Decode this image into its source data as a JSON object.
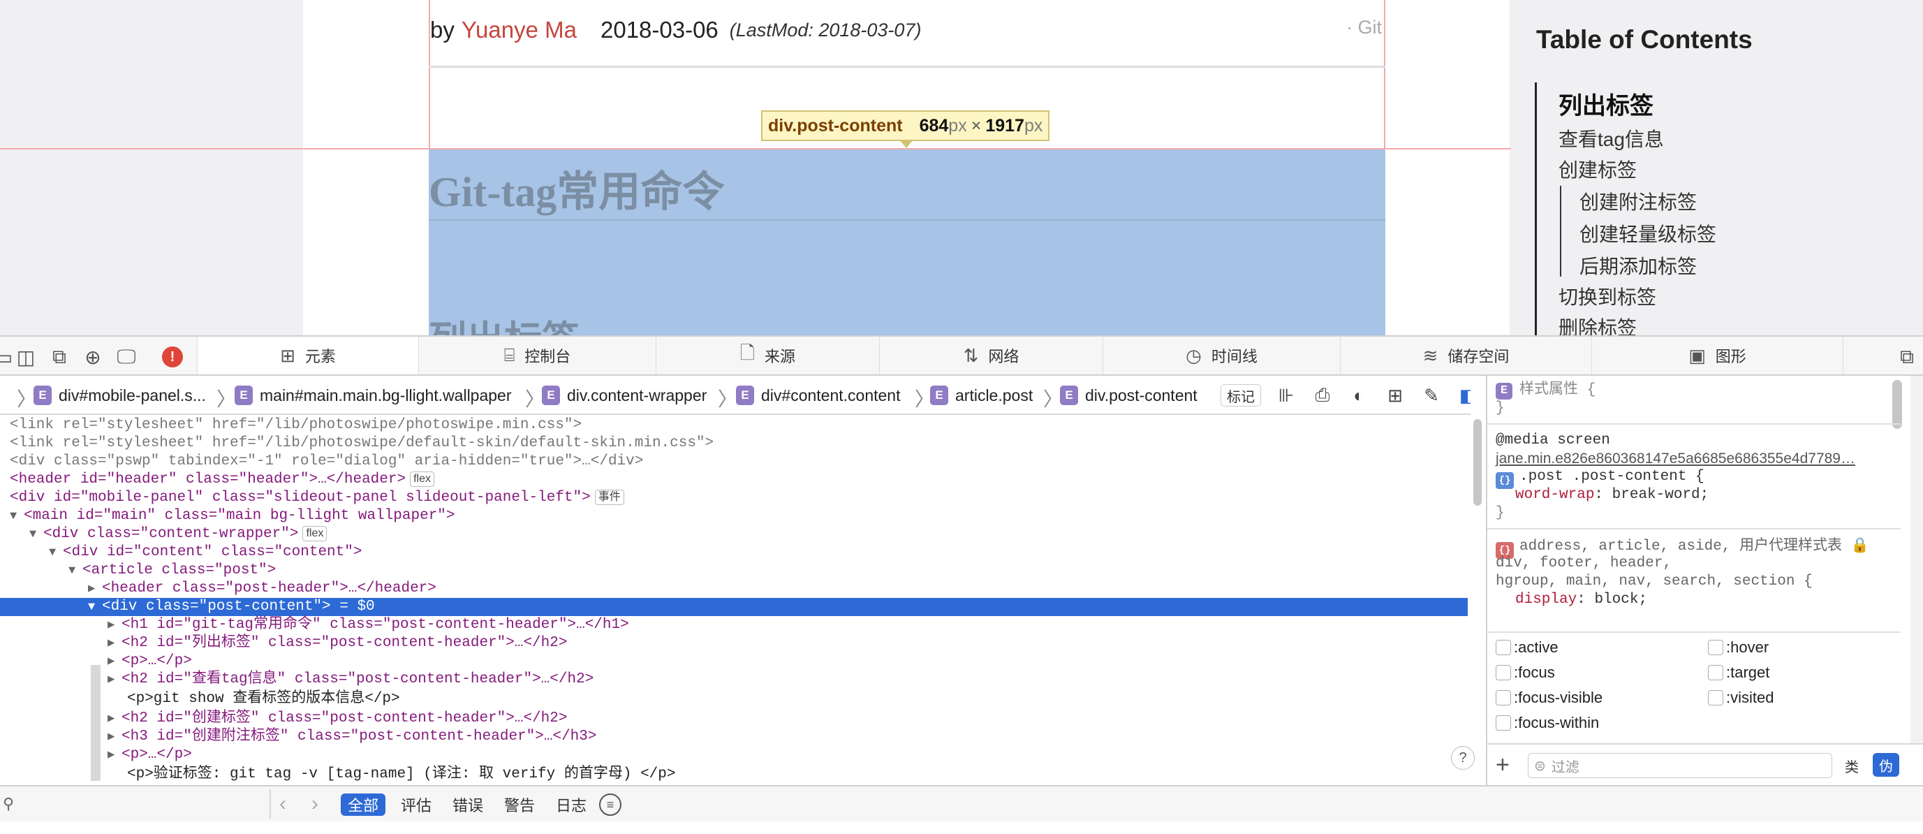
{
  "article": {
    "by_label": "by",
    "author": "Yuanye Ma",
    "date": "2018-03-06",
    "lastmod": "(LastMod: 2018-03-07)",
    "git_link": "· Git",
    "h1": "Git-tag常用命令",
    "h2_partial": "列出标签"
  },
  "tooltip": {
    "selector": "div.post-content",
    "width": "684",
    "height": "1917",
    "unit": "px",
    "times": "×"
  },
  "toc": {
    "title": "Table of Contents",
    "items": [
      {
        "label": "列出标签",
        "active": true
      },
      {
        "label": "查看tag信息"
      },
      {
        "label": "创建标签"
      },
      {
        "label": "创建附注标签"
      },
      {
        "label": "创建轻量级标签"
      },
      {
        "label": "后期添加标签"
      },
      {
        "label": "切换到标签"
      },
      {
        "label": "删除标签"
      }
    ]
  },
  "devtools": {
    "tabs": [
      {
        "label": "元素",
        "icon": "elements-icon"
      },
      {
        "label": "控制台",
        "icon": "console-icon"
      },
      {
        "label": "来源",
        "icon": "sources-icon"
      },
      {
        "label": "网络",
        "icon": "network-icon"
      },
      {
        "label": "时间线",
        "icon": "timeline-icon"
      },
      {
        "label": "储存空间",
        "icon": "storage-icon"
      },
      {
        "label": "图形",
        "icon": "graphics-icon"
      }
    ],
    "error_badge": "!",
    "breadcrumb": [
      {
        "badge": "E",
        "label": "div#mobile-panel.s..."
      },
      {
        "badge": "E",
        "label": "main#main.main.bg-llight.wallpaper"
      },
      {
        "badge": "E",
        "label": "div.content-wrapper"
      },
      {
        "badge": "E",
        "label": "div#content.content"
      },
      {
        "badge": "E",
        "label": "article.post"
      },
      {
        "badge": "E",
        "label": "div.post-content"
      }
    ],
    "mark_label": "标记",
    "dom_lines": {
      "l0": "<link rel=\"stylesheet\" href=\"/lib/photoswipe/photoswipe.min.css\">",
      "l1": "<link rel=\"stylesheet\" href=\"/lib/photoswipe/default-skin/default-skin.min.css\">",
      "l2": "<div class=\"pswp\" tabindex=\"-1\" role=\"dialog\" aria-hidden=\"true\">…</div>",
      "l3": "<header id=\"header\" class=\"header\">…</header>",
      "l3_badge": "flex",
      "l4": "<div id=\"mobile-panel\" class=\"slideout-panel slideout-panel-left\">",
      "l4_badge": "事件",
      "l5": "<main id=\"main\" class=\"main bg-llight wallpaper\">",
      "l6": "<div class=\"content-wrapper\">",
      "l6_badge": "flex",
      "l7": "<div id=\"content\" class=\"content\">",
      "l8": "<article class=\"post\">",
      "l9": "<header class=\"post-header\">…</header>",
      "l10": "<div class=\"post-content\"> = $0",
      "l11": "<h1 id=\"git-tag常用命令\" class=\"post-content-header\">…</h1>",
      "l12": "<h2 id=\"列出标签\" class=\"post-content-header\">…</h2>",
      "l13": "<p>…</p>",
      "l14": "<h2 id=\"查看tag信息\" class=\"post-content-header\">…</h2>",
      "l15": "<p>git show 查看标签的版本信息</p>",
      "l16": "<h2 id=\"创建标签\" class=\"post-content-header\">…</h2>",
      "l17": "<h3 id=\"创建附注标签\" class=\"post-content-header\">…</h3>",
      "l18": "<p>…</p>",
      "l19": "<p>验证标签: git tag -v [tag-name] (译注: 取 verify 的首字母) </p>"
    },
    "styles": {
      "style_attr_label": "样式属性 {",
      "close_brace": "}",
      "media": "@media screen",
      "source_link": "jane.min.e826e860368147e5a6685e686355e4d7789…",
      "rule1_selector": ".post .post-content {",
      "rule1_prop": "word-wrap",
      "rule1_value": "break-word;",
      "rule2_selector": "address, article, aside,",
      "ua_label": "用户代理样式表",
      "rule2_line2": "div, footer, header,",
      "rule2_line3": "hgroup, main, nav, search, section {",
      "rule2_prop": "display",
      "rule2_value": "block;"
    },
    "pseudo_classes": [
      ":active",
      ":hover",
      ":focus",
      ":target",
      ":focus-visible",
      ":visited",
      ":focus-within"
    ],
    "filter_placeholder": "过滤",
    "class_btn": "类",
    "pseudo_btn": "伪",
    "console_filters": [
      "全部",
      "评估",
      "错误",
      "警告",
      "日志"
    ],
    "help": "?"
  }
}
